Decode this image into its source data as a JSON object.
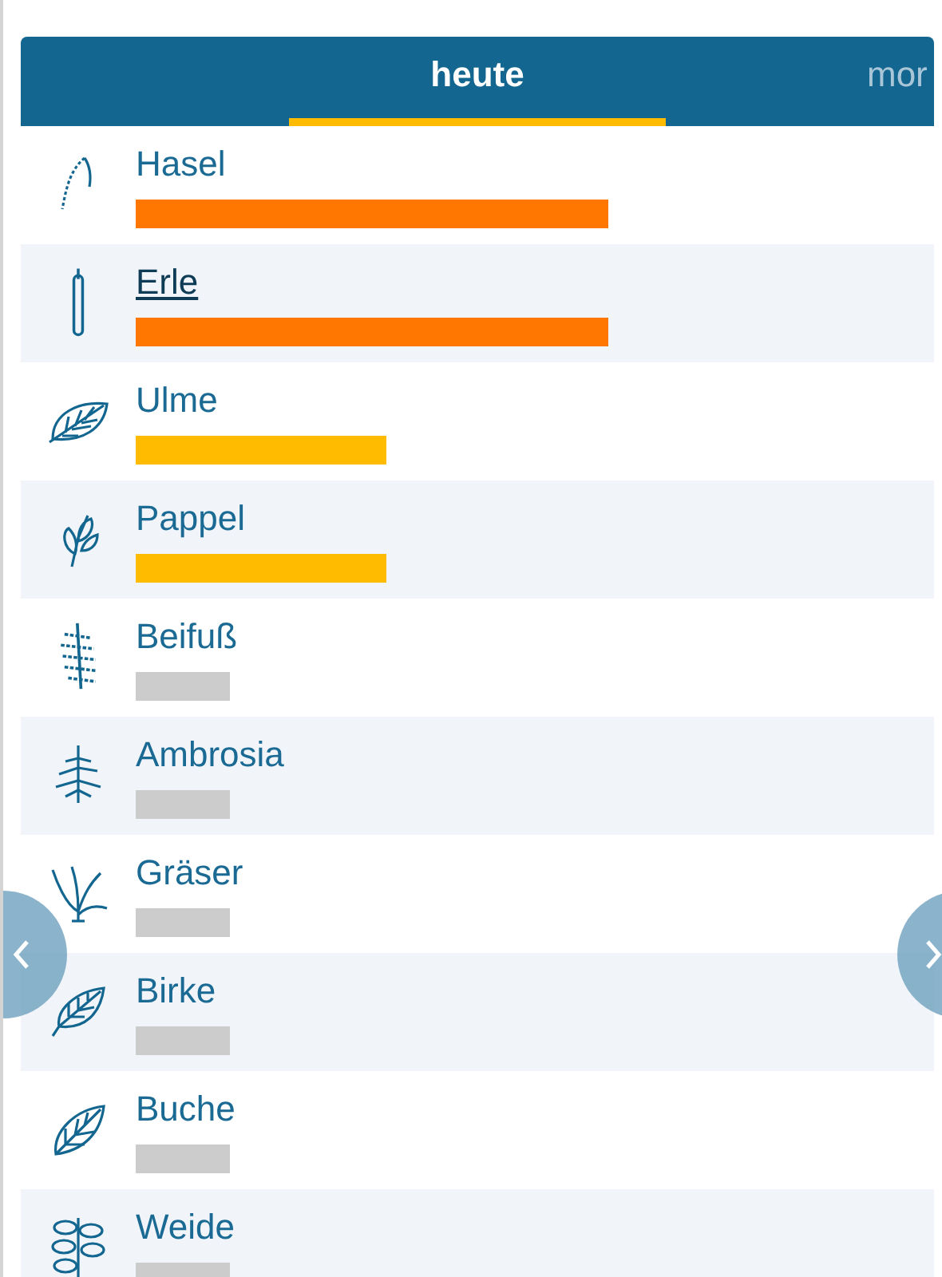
{
  "tabs": [
    {
      "label": "heute",
      "selected": true
    },
    {
      "label": "mor",
      "selected": false
    }
  ],
  "allergens": [
    {
      "name": "Hasel",
      "selected": false,
      "kind": "strong",
      "color": "#ff7700"
    },
    {
      "name": "Erle",
      "selected": true,
      "kind": "strong",
      "color": "#ff7700"
    },
    {
      "name": "Ulme",
      "selected": false,
      "kind": "moderate",
      "color": "#ffbb00"
    },
    {
      "name": "Pappel",
      "selected": false,
      "kind": "moderate",
      "color": "#ffbb00"
    },
    {
      "name": "Beifuß",
      "selected": false,
      "kind": "none",
      "color": "#cccccc"
    },
    {
      "name": "Ambrosia",
      "selected": false,
      "kind": "none",
      "color": "#cccccc"
    },
    {
      "name": "Gräser",
      "selected": false,
      "kind": "none",
      "color": "#cccccc"
    },
    {
      "name": "Birke",
      "selected": false,
      "kind": "none",
      "color": "#cccccc"
    },
    {
      "name": "Buche",
      "selected": false,
      "kind": "none",
      "color": "#cccccc"
    },
    {
      "name": "Weide",
      "selected": false,
      "kind": "none",
      "color": "#cccccc"
    }
  ]
}
